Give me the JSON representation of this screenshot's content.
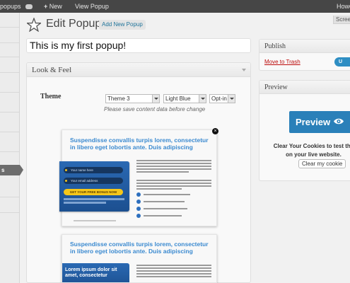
{
  "admin_bar": {
    "site_name": "popups",
    "new_label": "New",
    "view_label": "View Popup",
    "howdy": "Howd"
  },
  "header": {
    "title": "Edit Popup",
    "add_new": "Add New Popup",
    "screen_options": "Screen"
  },
  "left_menu": {
    "active_label": "s"
  },
  "post": {
    "title": "This is my first popup!"
  },
  "look_feel": {
    "heading": "Look & Feel",
    "theme_label": "Theme",
    "theme_value": "Theme 3",
    "color_value": "Light Blue",
    "optin_value": "Opt-in",
    "save_note": "Please save content data before change"
  },
  "popup_previews": [
    {
      "title": "Suspendisse convallis turpis lorem, consectetur in libero eget lobortis ante. Duis adipiscing",
      "name_placeholder": "Your name here",
      "email_placeholder": "Your email address",
      "button_label": "GET YOUR FREE BONUS NOW"
    },
    {
      "title": "Suspendisse convallis turpis lorem, consectetur in libero eget lobortis ante. Duis adipiscing",
      "blue_title": "Lorem ipsum dolor sit amet, consectetur"
    }
  ],
  "publish": {
    "heading": "Publish",
    "trash": "Move to Trash",
    "update": "U"
  },
  "preview_panel": {
    "heading": "Preview",
    "button": "Preview",
    "cookie_text": "Clear Your Cookies to test the on your live website.",
    "clear_button": "Clear my cookie"
  },
  "colors": {
    "accent": "#2a80b9",
    "popup_title": "#3b8ad0",
    "trash": "#bc0b0b"
  }
}
